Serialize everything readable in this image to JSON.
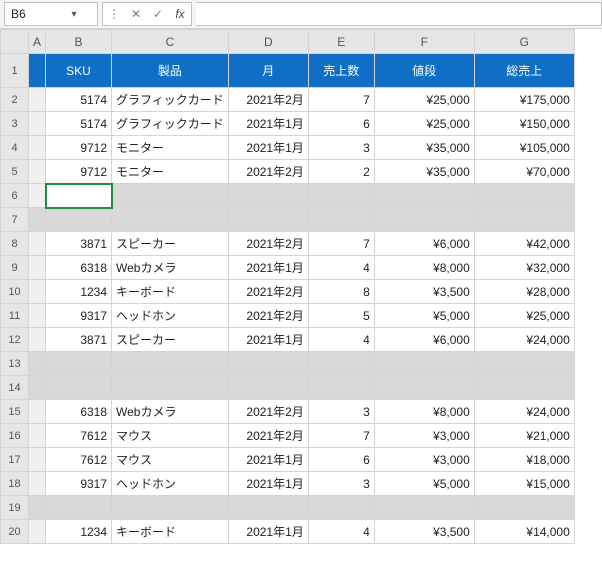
{
  "formula_bar": {
    "cell_ref": "B6",
    "cancel": "✕",
    "accept": "✓",
    "fx": "fx",
    "formula": ""
  },
  "col_headers": [
    "A",
    "B",
    "C",
    "D",
    "E",
    "F",
    "G"
  ],
  "row_headers": [
    "1",
    "2",
    "3",
    "4",
    "5",
    "6",
    "7",
    "8",
    "9",
    "10",
    "11",
    "12",
    "13",
    "14",
    "15",
    "16",
    "17",
    "18",
    "19",
    "20"
  ],
  "headers": {
    "sku": "SKU",
    "product": "製品",
    "month": "月",
    "units": "売上数",
    "price": "値段",
    "total": "総売上"
  },
  "rows": {
    "2": {
      "sku": "5174",
      "product": "グラフィックカード",
      "month": "2021年2月",
      "units": "7",
      "price": "¥25,000",
      "total": "¥175,000"
    },
    "3": {
      "sku": "5174",
      "product": "グラフィックカード",
      "month": "2021年1月",
      "units": "6",
      "price": "¥25,000",
      "total": "¥150,000"
    },
    "4": {
      "sku": "9712",
      "product": "モニター",
      "month": "2021年1月",
      "units": "3",
      "price": "¥35,000",
      "total": "¥105,000"
    },
    "5": {
      "sku": "9712",
      "product": "モニター",
      "month": "2021年2月",
      "units": "2",
      "price": "¥35,000",
      "total": "¥70,000"
    },
    "8": {
      "sku": "3871",
      "product": "スピーカー",
      "month": "2021年2月",
      "units": "7",
      "price": "¥6,000",
      "total": "¥42,000"
    },
    "9": {
      "sku": "6318",
      "product": "Webカメラ",
      "month": "2021年1月",
      "units": "4",
      "price": "¥8,000",
      "total": "¥32,000"
    },
    "10": {
      "sku": "1234",
      "product": "キーボード",
      "month": "2021年2月",
      "units": "8",
      "price": "¥3,500",
      "total": "¥28,000"
    },
    "11": {
      "sku": "9317",
      "product": "ヘッドホン",
      "month": "2021年2月",
      "units": "5",
      "price": "¥5,000",
      "total": "¥25,000"
    },
    "12": {
      "sku": "3871",
      "product": "スピーカー",
      "month": "2021年1月",
      "units": "4",
      "price": "¥6,000",
      "total": "¥24,000"
    },
    "15": {
      "sku": "6318",
      "product": "Webカメラ",
      "month": "2021年2月",
      "units": "3",
      "price": "¥8,000",
      "total": "¥24,000"
    },
    "16": {
      "sku": "7612",
      "product": "マウス",
      "month": "2021年2月",
      "units": "7",
      "price": "¥3,000",
      "total": "¥21,000"
    },
    "17": {
      "sku": "7612",
      "product": "マウス",
      "month": "2021年1月",
      "units": "6",
      "price": "¥3,000",
      "total": "¥18,000"
    },
    "18": {
      "sku": "9317",
      "product": "ヘッドホン",
      "month": "2021年1月",
      "units": "3",
      "price": "¥5,000",
      "total": "¥15,000"
    },
    "20": {
      "sku": "1234",
      "product": "キーボード",
      "month": "2021年1月",
      "units": "4",
      "price": "¥3,500",
      "total": "¥14,000"
    }
  }
}
